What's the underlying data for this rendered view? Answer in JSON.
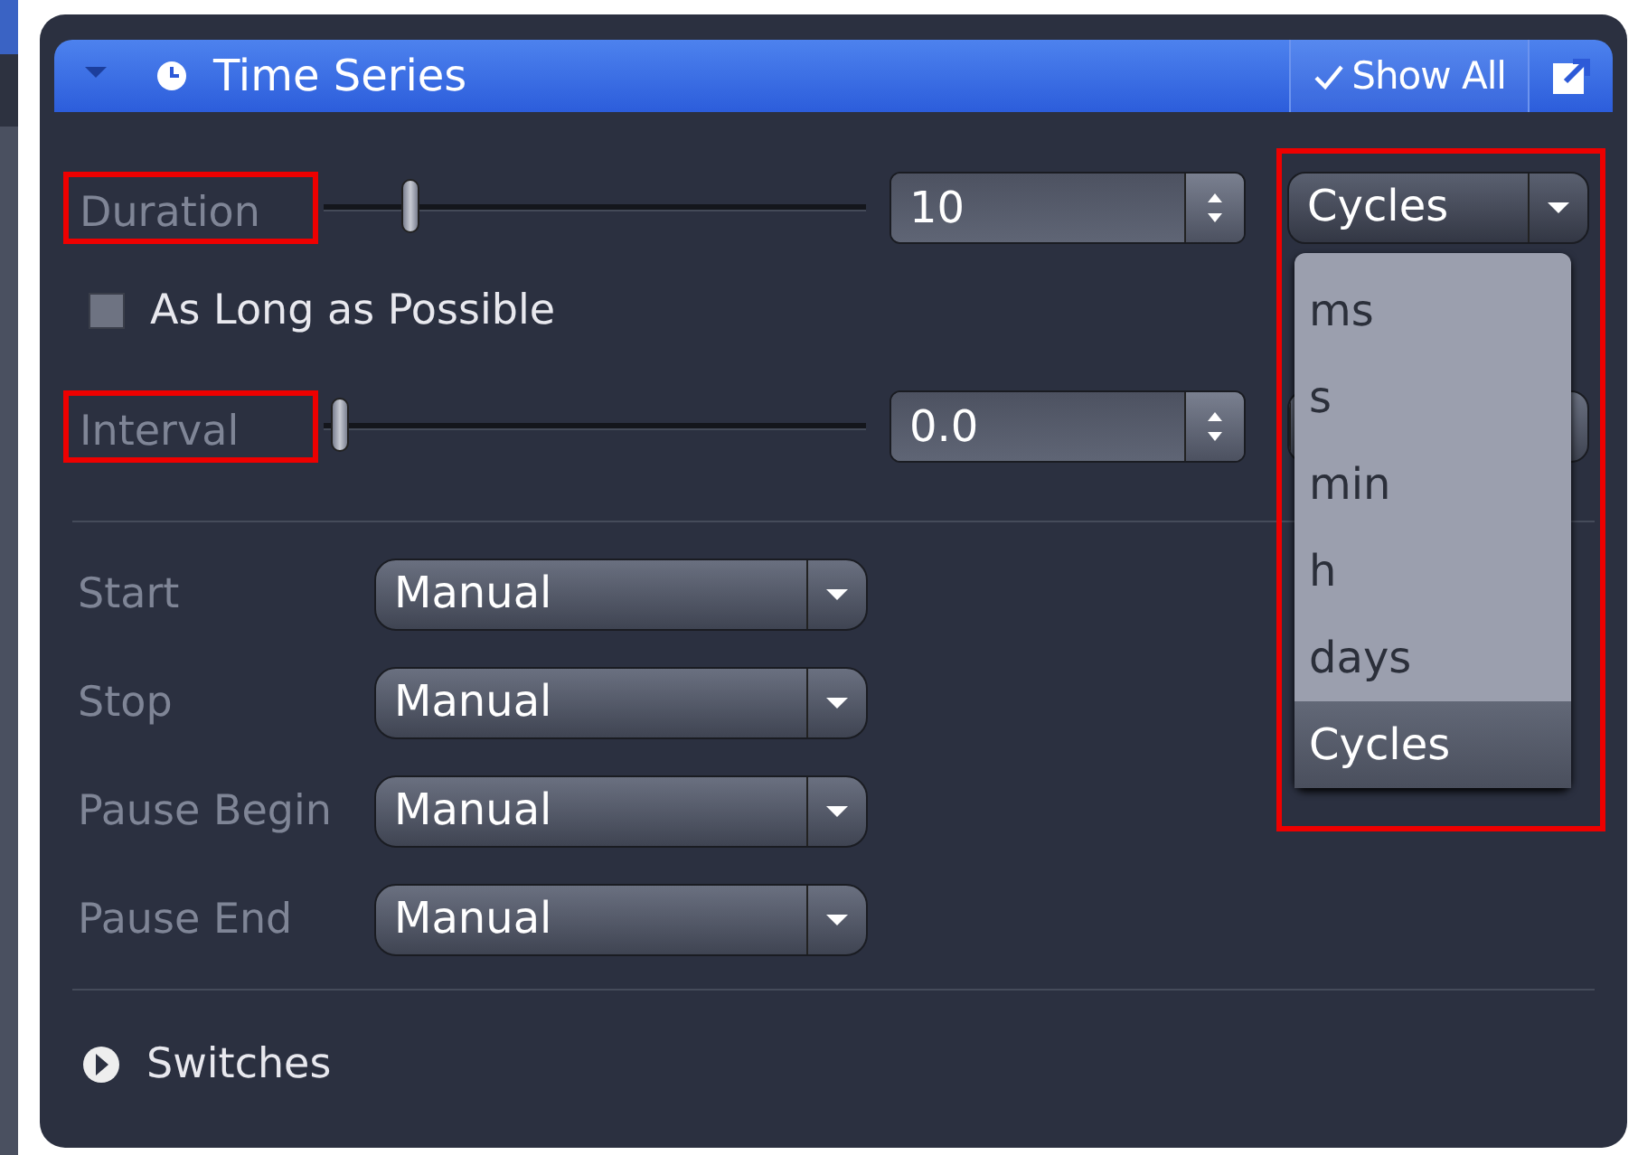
{
  "panel": {
    "title": "Time Series",
    "expanded": true,
    "show_all": {
      "label": "Show All",
      "checked": true
    }
  },
  "duration": {
    "label": "Duration",
    "highlighted": true,
    "level": 0.14,
    "value": "10",
    "unit": {
      "value": "Cycles",
      "open": true,
      "highlighted": true,
      "options": [
        {
          "label": "ms",
          "selected": false
        },
        {
          "label": "s",
          "selected": false
        },
        {
          "label": "min",
          "selected": false
        },
        {
          "label": "h",
          "selected": false
        },
        {
          "label": "days",
          "selected": false
        },
        {
          "label": "Cycles",
          "selected": true
        }
      ]
    }
  },
  "as_long_as_possible": {
    "label": "As Long as Possible",
    "checked": false
  },
  "interval": {
    "label": "Interval",
    "highlighted": true,
    "level": 0,
    "value": "0.0"
  },
  "triggers": [
    {
      "label": "Start",
      "value": "Manual"
    },
    {
      "label": "Stop",
      "value": "Manual"
    },
    {
      "label": "Pause Begin",
      "value": "Manual"
    },
    {
      "label": "Pause End",
      "value": "Manual"
    }
  ],
  "switches": {
    "label": "Switches",
    "expanded": false
  }
}
